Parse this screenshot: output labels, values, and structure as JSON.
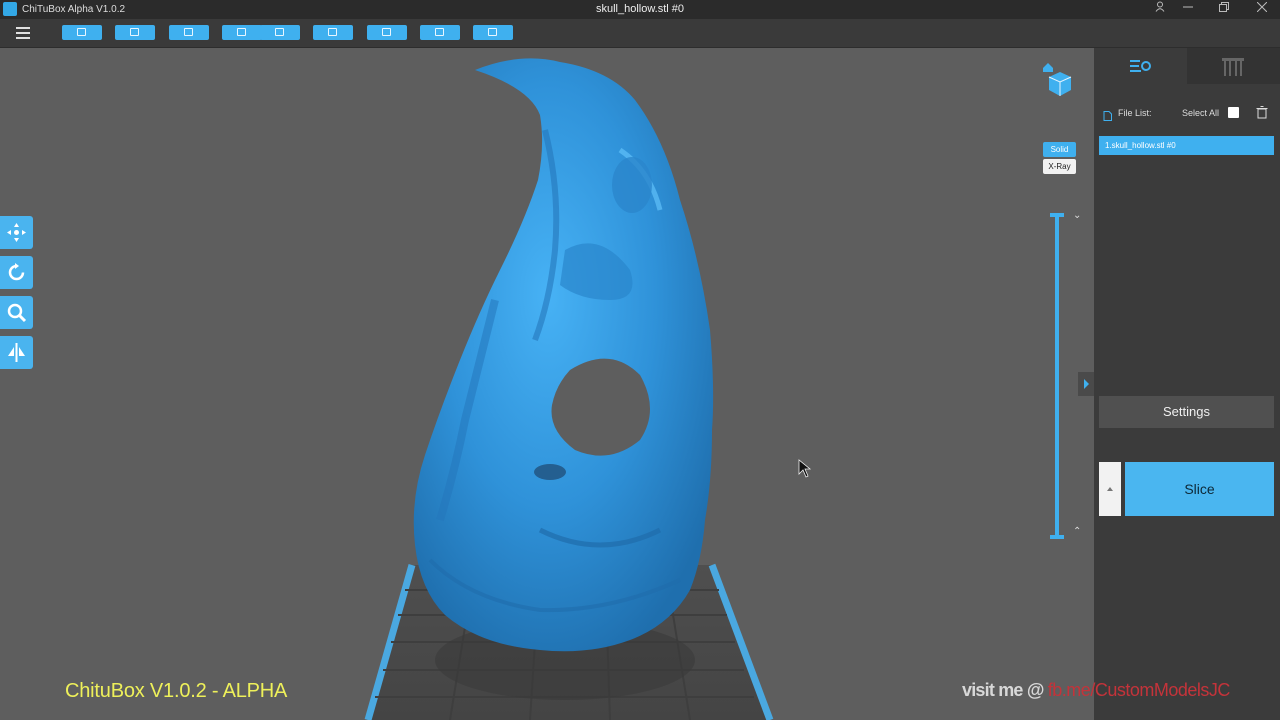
{
  "window": {
    "app_title": "ChiTuBox Alpha V1.0.2",
    "doc_title": "skull_hollow.stl #0"
  },
  "toolbar": {
    "buttons": [
      "open-file",
      "save-file",
      "select",
      "undo",
      "redo",
      "copy",
      "layout",
      "support",
      "hollow"
    ]
  },
  "view_modes": {
    "solid_label": "Solid",
    "xray_label": "X-Ray",
    "active": "Solid"
  },
  "left_tools": [
    "move-tool",
    "rotate-tool",
    "scale-tool",
    "mirror-tool"
  ],
  "panel": {
    "file_list_label": "File List:",
    "select_all_label": "Select All",
    "files": [
      "1.skull_hollow.stl #0"
    ],
    "settings_label": "Settings",
    "slice_label": "Slice"
  },
  "overlay": {
    "version_text": "ChituBox V1.0.2 - ALPHA",
    "visit_prefix": "visit me @ ",
    "visit_link": "fb.me/CustomModelsJC"
  },
  "colors": {
    "accent": "#3fb0ef",
    "model": "#3499dd",
    "background": "#5e5e5e",
    "panel": "#3b3b3b"
  }
}
